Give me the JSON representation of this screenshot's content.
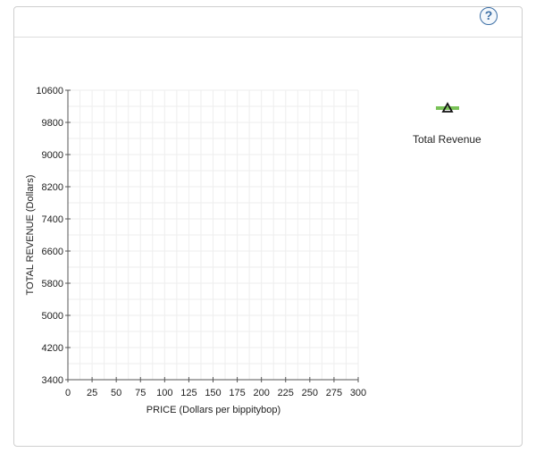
{
  "help": {
    "label": "?"
  },
  "chart_data": {
    "type": "line",
    "xlabel": "PRICE (Dollars per bippitybop)",
    "ylabel": "TOTAL REVENUE (Dollars)",
    "xlim": [
      0,
      300
    ],
    "ylim": [
      3400,
      10600
    ],
    "x_ticks": [
      0,
      25,
      50,
      75,
      100,
      125,
      150,
      175,
      200,
      225,
      250,
      275,
      300
    ],
    "y_ticks": [
      3400,
      4200,
      5000,
      5800,
      6600,
      7400,
      8200,
      9000,
      9800,
      10600
    ],
    "grid": true,
    "legend": {
      "position": "right",
      "marker": "triangle",
      "color": "#79c257"
    },
    "series": [
      {
        "name": "Total Revenue",
        "color": "#79c257",
        "marker": "triangle",
        "points": []
      }
    ]
  }
}
